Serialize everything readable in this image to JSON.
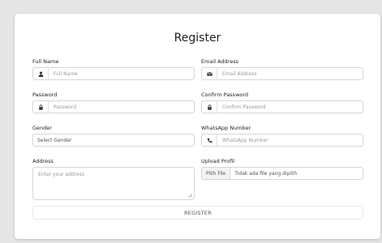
{
  "form": {
    "title": "Register",
    "full_name": {
      "label": "Full Name",
      "placeholder": "Full Name",
      "icon": "user-icon"
    },
    "email": {
      "label": "Email Address",
      "placeholder": "Email Address",
      "icon": "envelope-icon"
    },
    "password": {
      "label": "Password",
      "placeholder": "Password",
      "icon": "lock-icon"
    },
    "confirm_password": {
      "label": "Confirm Password",
      "placeholder": "Confirm Password",
      "icon": "lock-icon"
    },
    "gender": {
      "label": "Gender",
      "value": "Select Gender"
    },
    "whatsapp": {
      "label": "WhatsApp Number",
      "placeholder": "WhatsApp Number",
      "icon": "phone-icon"
    },
    "address": {
      "label": "Address",
      "placeholder": "Enter your address"
    },
    "upload": {
      "label": "Upload Profil",
      "button": "Pilih File",
      "status": "Tidak ada file yang dipilih"
    },
    "submit_label": "REGISTER"
  },
  "colors": {
    "page_bg": "#e6e6e6",
    "card_bg": "#ffffff",
    "border": "#d6d6d6",
    "placeholder": "#9a9a9a"
  }
}
